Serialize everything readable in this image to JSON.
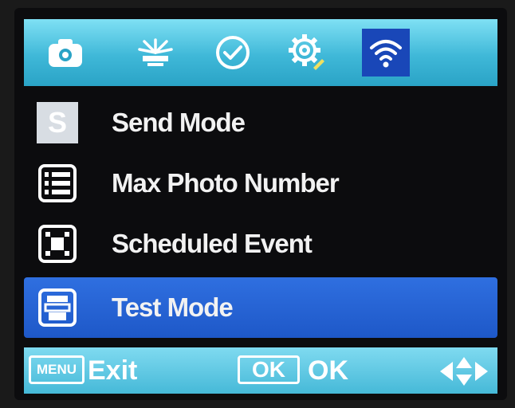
{
  "tabs": [
    {
      "name": "camera-tab",
      "icon": "camera-icon",
      "active": false
    },
    {
      "name": "trigger-tab",
      "icon": "antenna-icon",
      "active": false
    },
    {
      "name": "clock-tab",
      "icon": "clock-icon",
      "active": false
    },
    {
      "name": "settings-tab",
      "icon": "gear-icon",
      "active": false
    },
    {
      "name": "wifi-tab",
      "icon": "wifi-icon",
      "active": true
    }
  ],
  "menu": {
    "items": [
      {
        "label": "Send Mode",
        "icon": "send-mode-icon",
        "selected": false
      },
      {
        "label": "Max Photo Number",
        "icon": "list-icon",
        "selected": false
      },
      {
        "label": "Scheduled Event",
        "icon": "schedule-frame-icon",
        "selected": false
      },
      {
        "label": "Test Mode",
        "icon": "test-mode-icon",
        "selected": true
      }
    ],
    "send_mode_icon_letter": "S"
  },
  "footer": {
    "menu_key": "MENU",
    "exit_label": "Exit",
    "ok_key": "OK",
    "ok_label": "OK",
    "nav_icon": "arrows-icon"
  },
  "colors": {
    "tabbar": "#46b9d8",
    "active_tab": "#1947b8",
    "selected_row": "#1e58c8",
    "text": "#f2f2f2"
  }
}
